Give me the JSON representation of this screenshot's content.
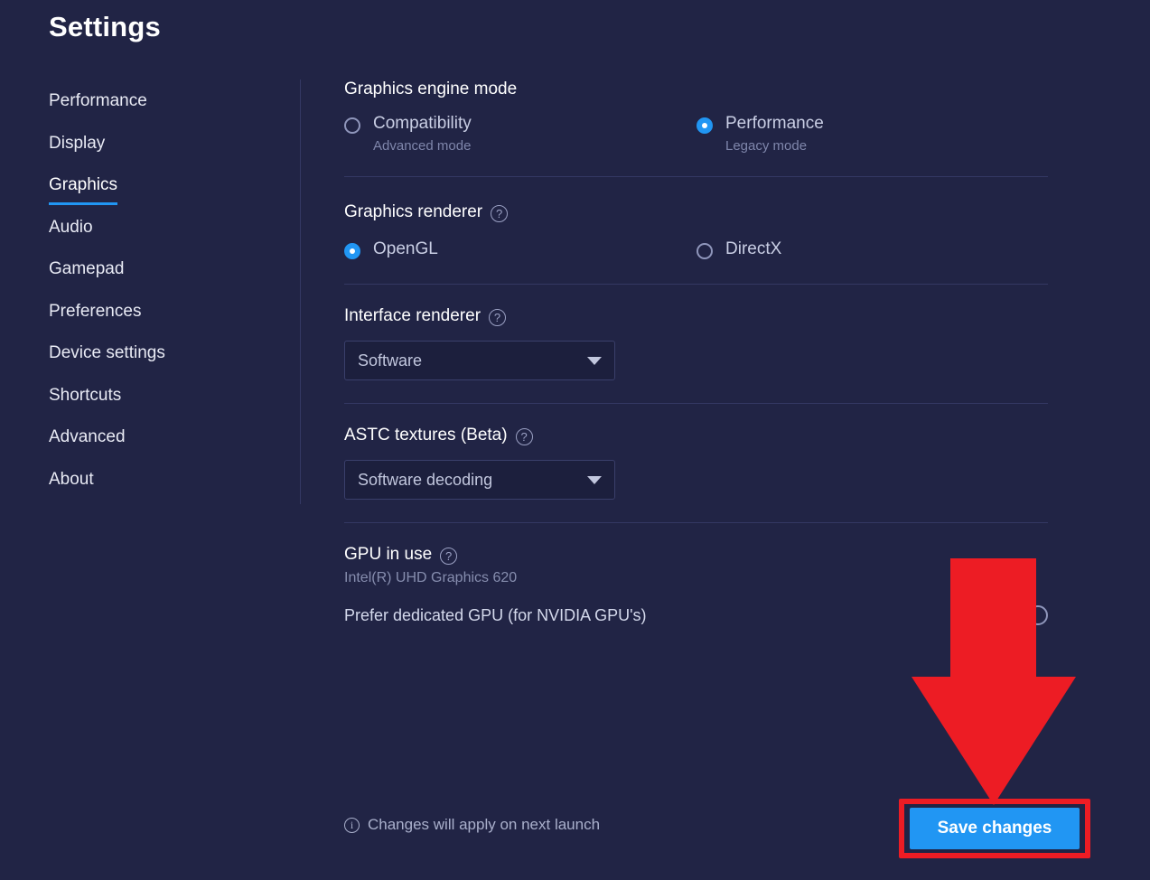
{
  "header": {
    "title": "Settings"
  },
  "sidebar": {
    "items": [
      {
        "label": "Performance",
        "active": false
      },
      {
        "label": "Display",
        "active": false
      },
      {
        "label": "Graphics",
        "active": true
      },
      {
        "label": "Audio",
        "active": false
      },
      {
        "label": "Gamepad",
        "active": false
      },
      {
        "label": "Preferences",
        "active": false
      },
      {
        "label": "Device settings",
        "active": false
      },
      {
        "label": "Shortcuts",
        "active": false
      },
      {
        "label": "Advanced",
        "active": false
      },
      {
        "label": "About",
        "active": false
      }
    ]
  },
  "main": {
    "engine_mode": {
      "title": "Graphics engine mode",
      "options": [
        {
          "label": "Compatibility",
          "sublabel": "Advanced mode",
          "selected": false
        },
        {
          "label": "Performance",
          "sublabel": "Legacy mode",
          "selected": true
        }
      ]
    },
    "graphics_renderer": {
      "title": "Graphics renderer",
      "help": "?",
      "options": [
        {
          "label": "OpenGL",
          "selected": true
        },
        {
          "label": "DirectX",
          "selected": false
        }
      ]
    },
    "interface_renderer": {
      "title": "Interface renderer",
      "help": "?",
      "value": "Software"
    },
    "astc_textures": {
      "title": "ASTC textures (Beta)",
      "help": "?",
      "value": "Software decoding"
    },
    "gpu": {
      "title": "GPU in use",
      "help": "?",
      "value": "Intel(R) UHD Graphics 620",
      "prefer_label": "Prefer dedicated GPU (for NVIDIA GPU's)",
      "prefer_enabled": false
    }
  },
  "footer": {
    "note_icon": "i",
    "note": "Changes will apply on next launch",
    "save_label": "Save changes"
  },
  "colors": {
    "background": "#212445",
    "accent": "#2196f3",
    "annotation": "#ED1C24",
    "divider": "#343863",
    "muted_text": "#7f86ab"
  }
}
